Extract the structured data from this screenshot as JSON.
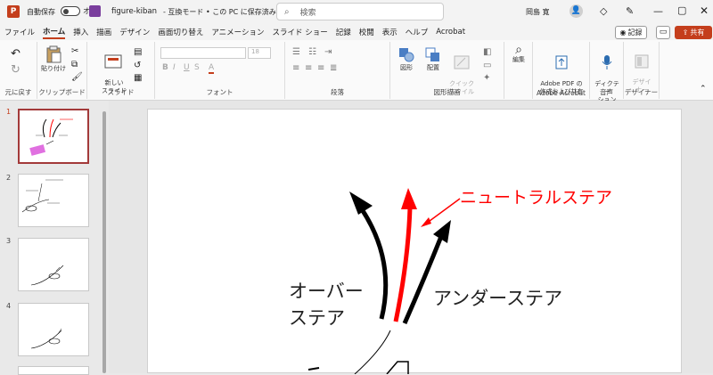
{
  "title_bar": {
    "autosave_label": "自動保存",
    "autosave_state": "オフ",
    "file_name": "figure-kiban",
    "doc_status": "-  互換モード • この PC に保存済み ⌄",
    "search_placeholder": "検索",
    "user_name": "岡島 寛"
  },
  "menu": {
    "tabs": [
      "ファイル",
      "ホーム",
      "挿入",
      "描画",
      "デザイン",
      "画面切り替え",
      "アニメーション",
      "スライド ショー",
      "記録",
      "校閲",
      "表示",
      "ヘルプ",
      "Acrobat"
    ],
    "record_button": "記録",
    "share_button": "共有"
  },
  "ribbon": {
    "undo_label": "元に戻す",
    "paste_label": "貼り付け",
    "clipboard_label": "クリップボード",
    "new_slide_label": "新しい\nスライド",
    "slides_label": "スライド",
    "font_label": "フォント",
    "paragraph_label": "段落",
    "shape_label": "図形",
    "arrange_label": "配置",
    "quick_style_label": "クイック\nスタイル",
    "drawing_label": "図形描画",
    "edit_label": "編集",
    "adobe_pdf_label": "Adobe PDF の\n作成および共有",
    "adobe_group_label": "Adobe Acrobat",
    "dictation_label": "ディクテー\nション",
    "voice_label": "音声",
    "designer_label": "デザイ\nナー",
    "designer_group_label": "デザイナー",
    "font_size": "18"
  },
  "thumbnails": {
    "numbers": [
      "1",
      "2",
      "3",
      "4"
    ]
  },
  "slide": {
    "neutral_label": "ニュートラルステア",
    "over_label_1": "オーバー",
    "over_label_2": "ステア",
    "under_label": "アンダーステア"
  },
  "colors": {
    "accent": "#c43e1c",
    "neutral_arrow": "#ff0000"
  }
}
